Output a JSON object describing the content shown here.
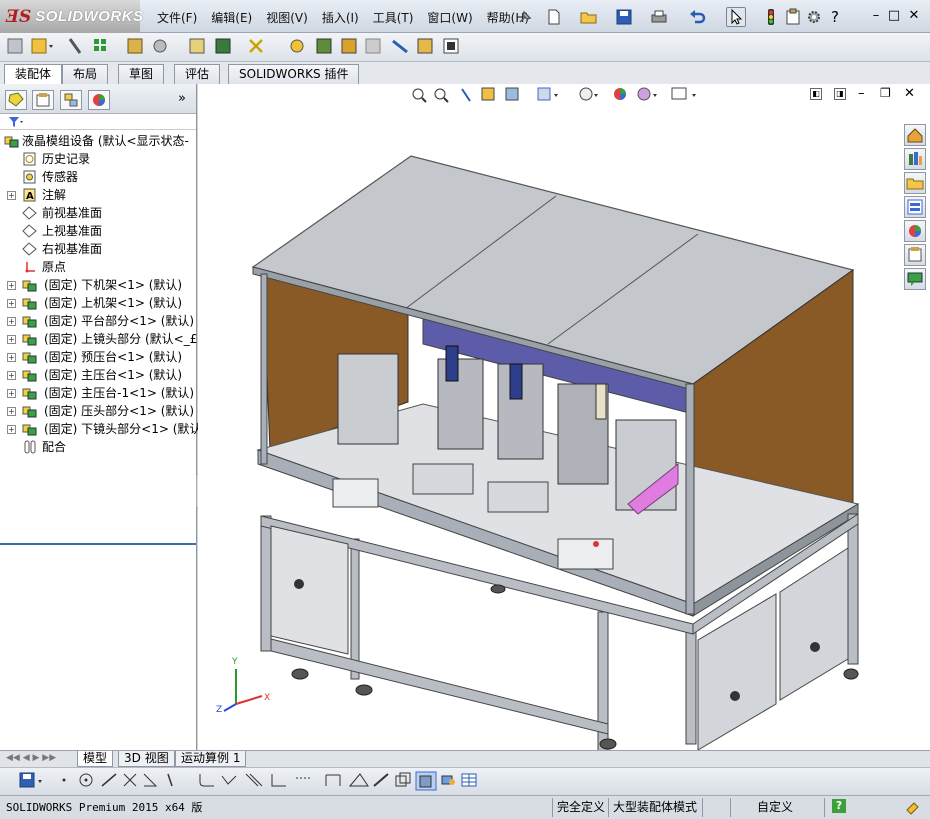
{
  "app": {
    "logo_ds": "ƎS",
    "logo_text": "SOLIDWORKS"
  },
  "menu": [
    "文件(F)",
    "编辑(E)",
    "视图(V)",
    "插入(I)",
    "工具(T)",
    "窗口(W)",
    "帮助(H)"
  ],
  "command_tabs": [
    "装配体",
    "布局",
    "草图",
    "评估",
    "SOLIDWORKS 插件"
  ],
  "active_command_tab": "装配体",
  "tree": {
    "root": "液晶模组设备  (默认<显示状态-",
    "items": [
      {
        "label": "历史记录",
        "icon": "history-icon",
        "expandable": false
      },
      {
        "label": "传感器",
        "icon": "sensor-icon",
        "expandable": false
      },
      {
        "label": "注解",
        "icon": "annotation-icon",
        "expandable": true
      },
      {
        "label": "前视基准面",
        "icon": "plane-icon",
        "expandable": false
      },
      {
        "label": "上视基准面",
        "icon": "plane-icon",
        "expandable": false
      },
      {
        "label": "右视基准面",
        "icon": "plane-icon",
        "expandable": false
      },
      {
        "label": "原点",
        "icon": "origin-icon",
        "expandable": false
      },
      {
        "label": "(固定) 下机架<1> (默认)",
        "icon": "assembly-icon",
        "expandable": true
      },
      {
        "label": "(固定) 上机架<1> (默认)",
        "icon": "assembly-icon",
        "expandable": true
      },
      {
        "label": "(固定) 平台部分<1> (默认)",
        "icon": "assembly-icon",
        "expandable": true
      },
      {
        "label": "(固定) 上镜头部分 (默认<_£",
        "icon": "assembly-icon",
        "expandable": true
      },
      {
        "label": "(固定) 预压台<1> (默认)",
        "icon": "assembly-icon",
        "expandable": true
      },
      {
        "label": "(固定) 主压台<1> (默认)",
        "icon": "assembly-icon",
        "expandable": true
      },
      {
        "label": "(固定) 主压台-1<1> (默认)",
        "icon": "assembly-icon",
        "expandable": true
      },
      {
        "label": "(固定) 压头部分<1> (默认)",
        "icon": "assembly-icon",
        "expandable": true
      },
      {
        "label": "(固定) 下镜头部分<1> (默认",
        "icon": "assembly-icon",
        "expandable": true
      },
      {
        "label": "配合",
        "icon": "mates-icon",
        "expandable": false
      }
    ]
  },
  "bottom_tabs": [
    "模型",
    "3D 视图",
    "运动算例 1"
  ],
  "active_bottom_tab": "模型",
  "status": {
    "product": "SOLIDWORKS Premium 2015 x64 版",
    "definition": "完全定义",
    "mode": "大型装配体模式",
    "units": "自定义",
    "help": "?"
  },
  "colors": {
    "panel_brown": "#8a5a26",
    "panel_blue": "#5c5ca8",
    "frame_gray": "#a9afb8",
    "roof_gray": "#c4c7cc",
    "accent_pink": "#e07be0"
  }
}
